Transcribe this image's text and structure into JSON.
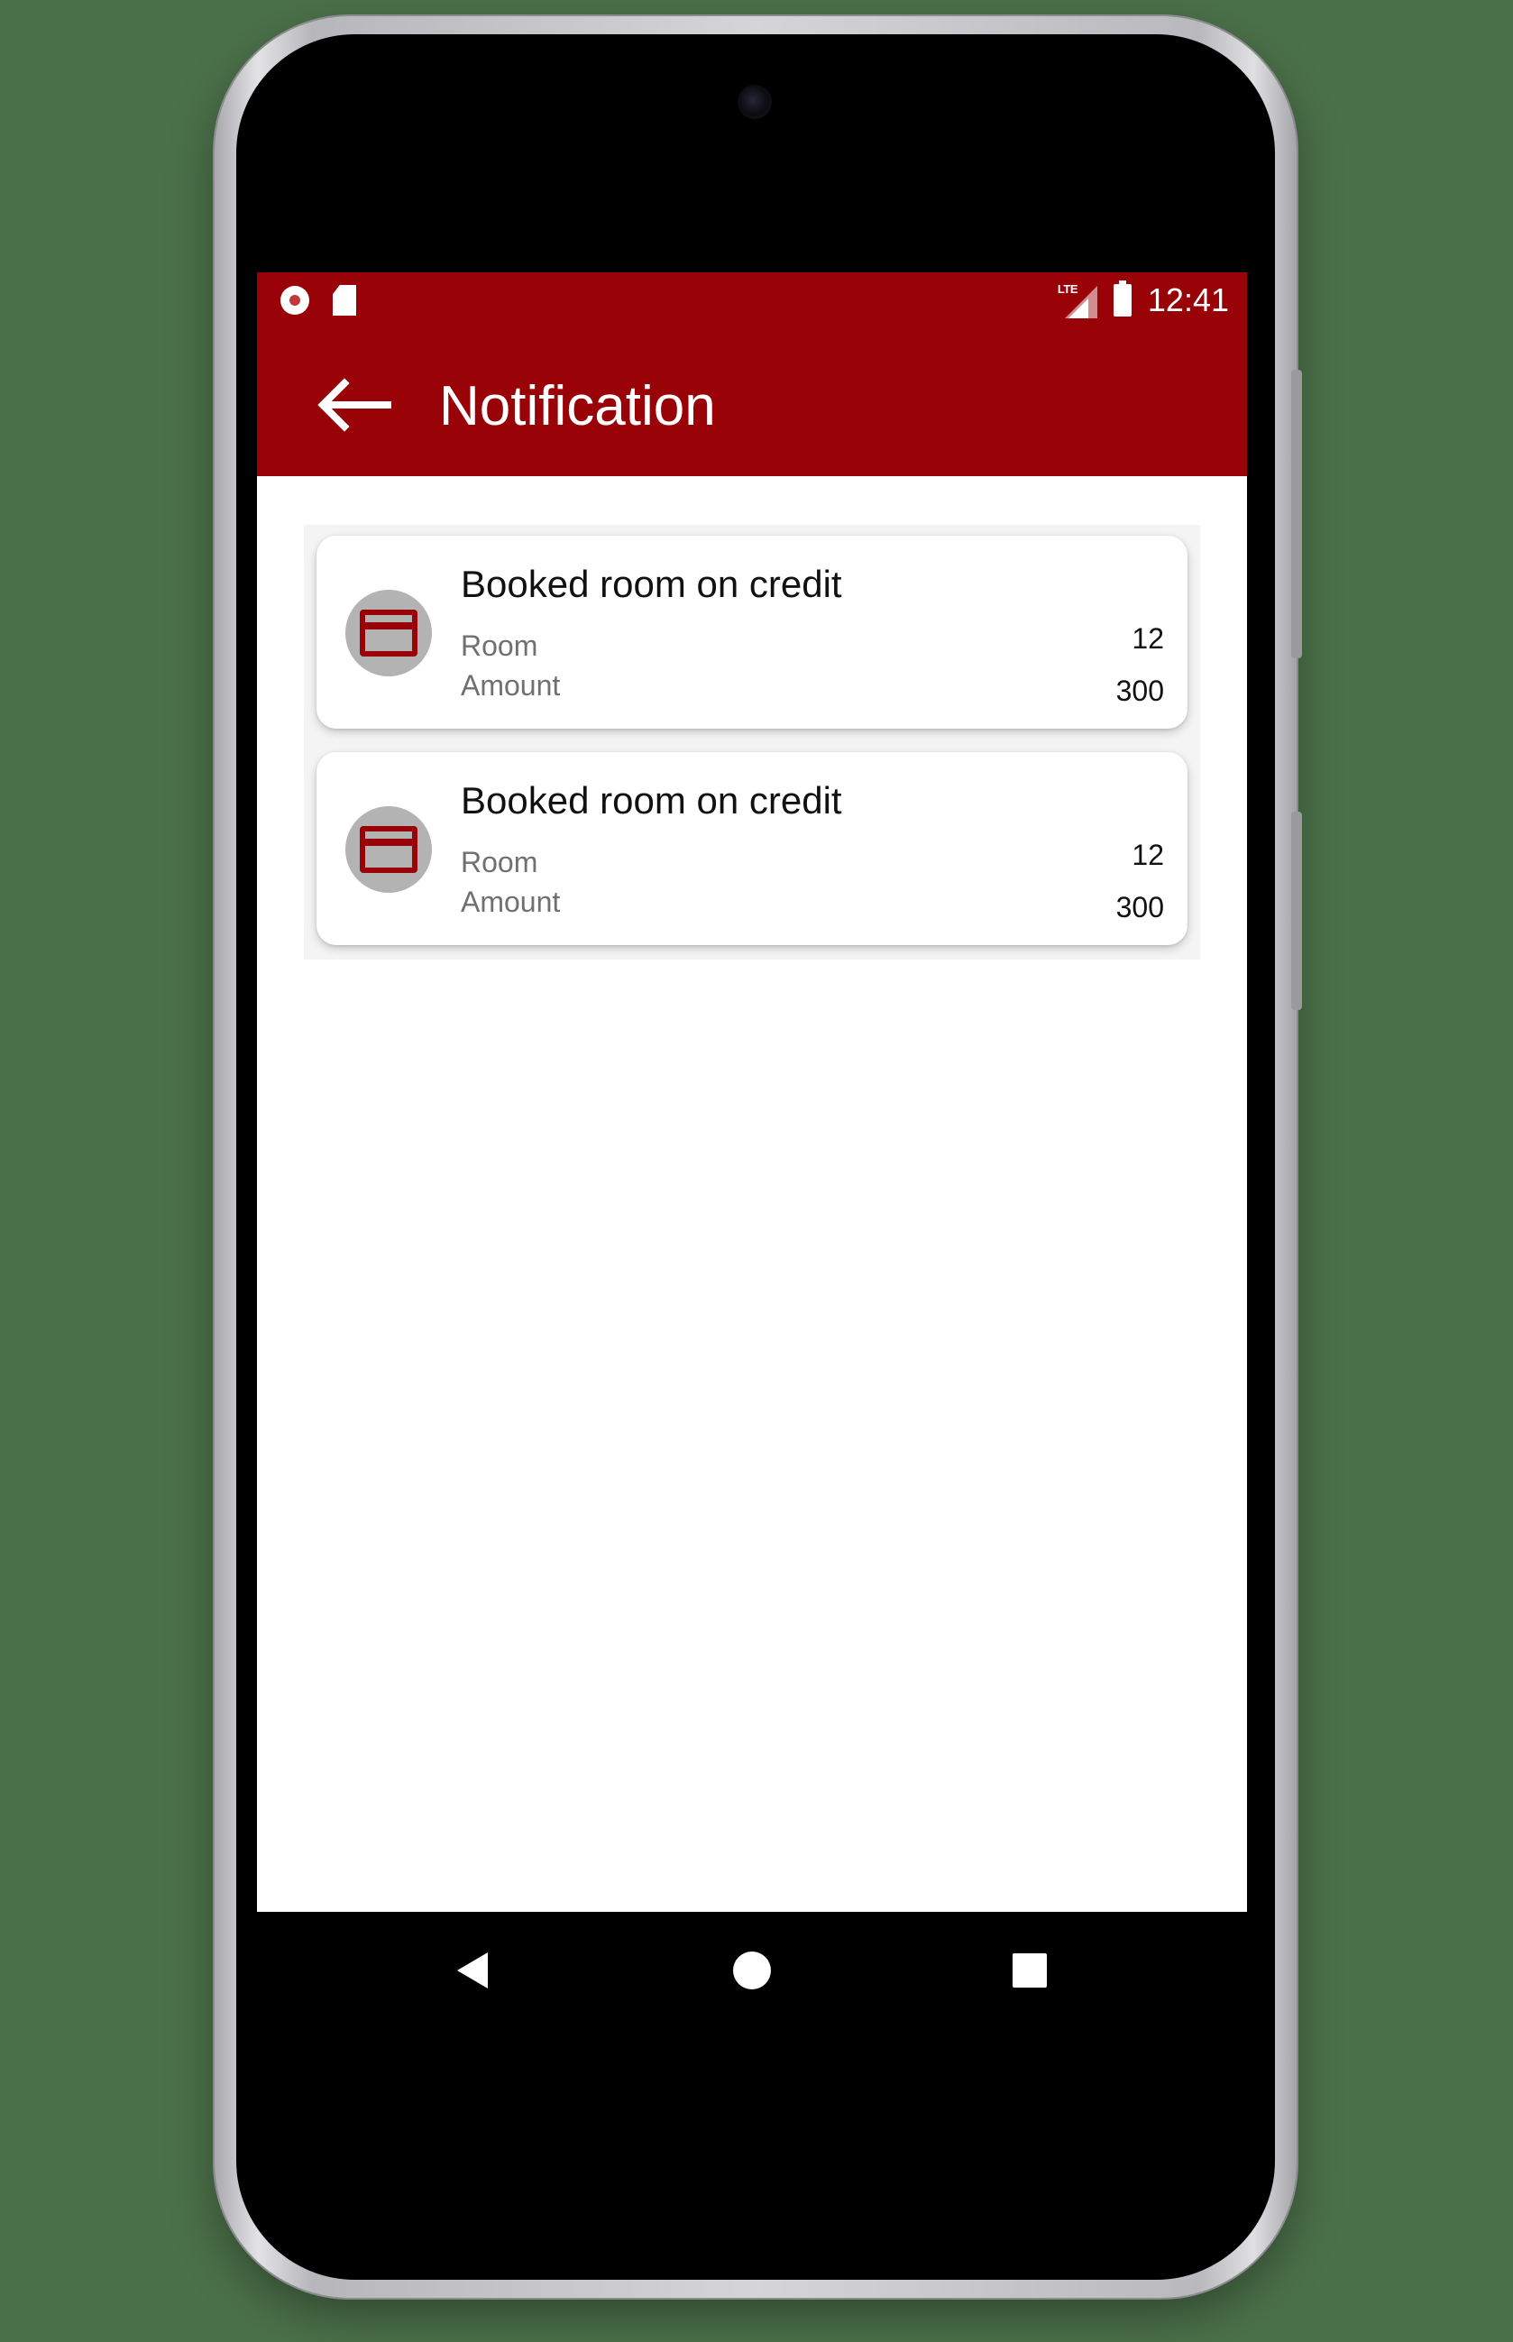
{
  "status_bar": {
    "time": "12:41",
    "network": "LTE",
    "icons": [
      "record-icon",
      "sd-card-icon",
      "lte-signal-icon",
      "battery-icon"
    ]
  },
  "app_bar": {
    "title": "Notification",
    "back_icon": "arrow-left-icon"
  },
  "notifications": [
    {
      "title": "Booked room on credit",
      "icon": "credit-card-icon",
      "room_label": "Room",
      "room_value": "12",
      "amount_label": "Amount",
      "amount_value": "300"
    },
    {
      "title": "Booked room on credit",
      "icon": "credit-card-icon",
      "room_label": "Room",
      "room_value": "12",
      "amount_label": "Amount",
      "amount_value": "300"
    }
  ],
  "nav_bar": {
    "icons": [
      "back-triangle-icon",
      "home-circle-icon",
      "recents-square-icon"
    ]
  },
  "colors": {
    "primary": "#990307",
    "avatar_bg": "#b3b3b3",
    "background": "#4b7149"
  }
}
